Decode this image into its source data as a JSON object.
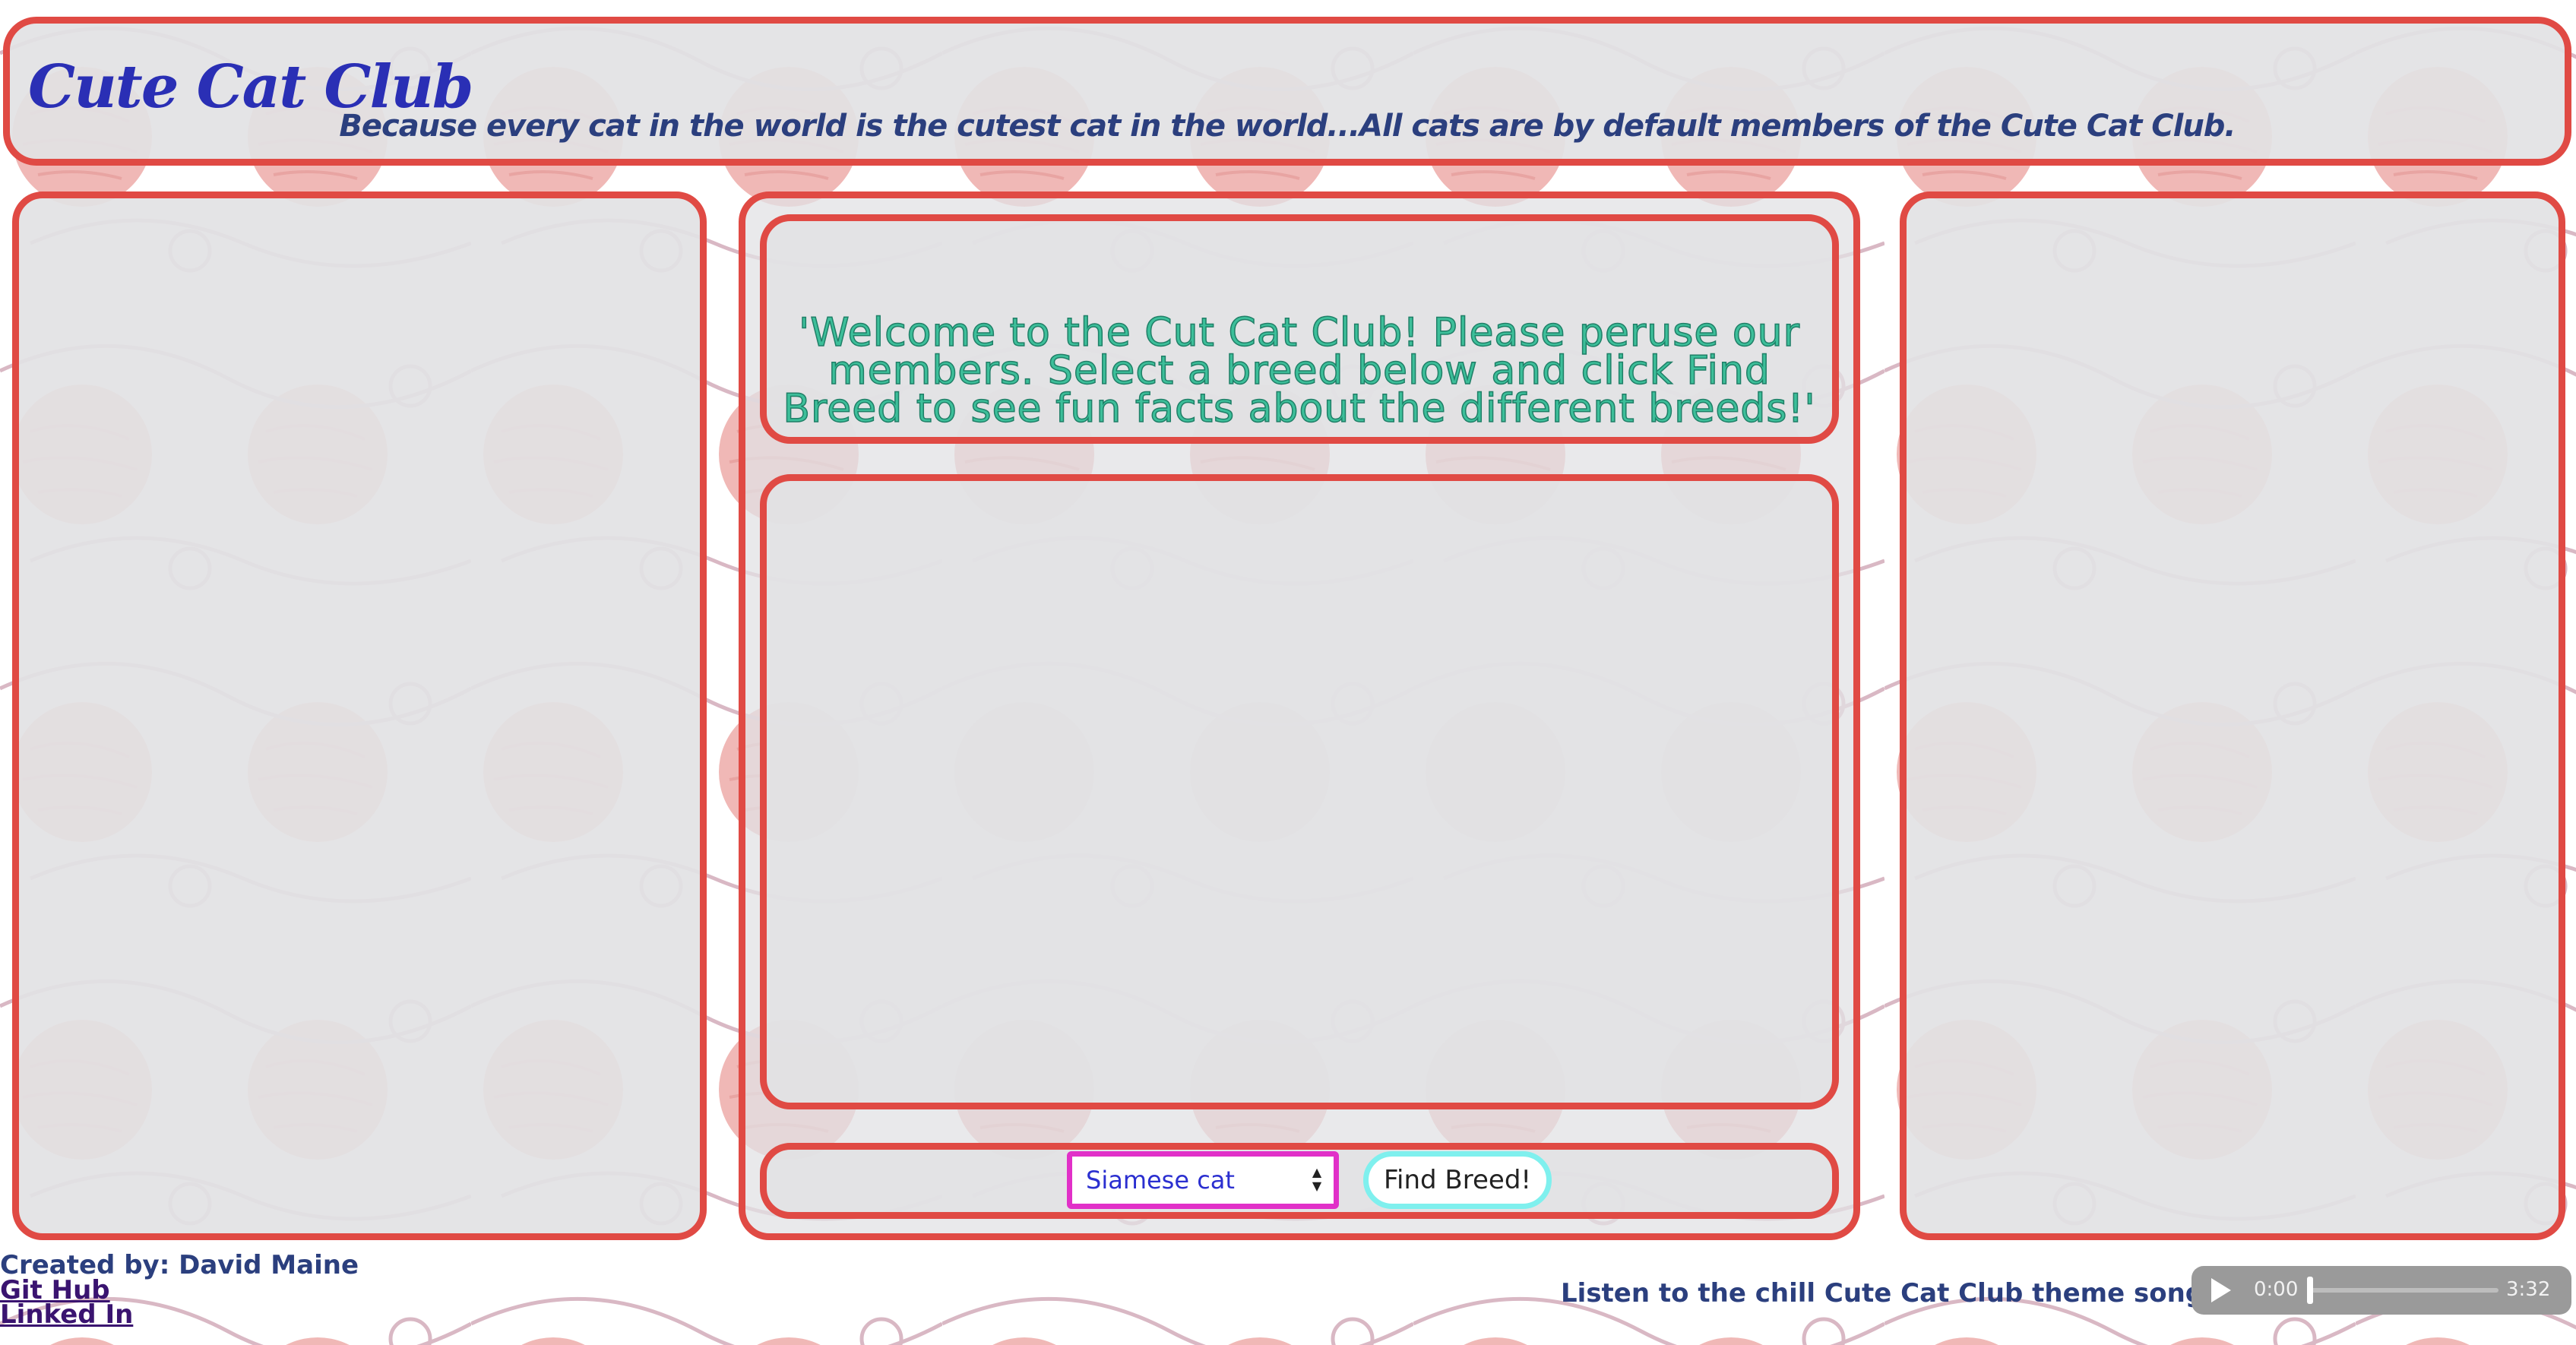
{
  "header": {
    "title": "Cute Cat Club",
    "tagline": "Because every cat in the world is the cutest cat in the world...All cats are by default members of the Cute Cat Club."
  },
  "welcome": {
    "message": "'Welcome to the Cut Cat Club! Please peruse our members. Select a breed below and click Find Breed to see fun facts about the different breeds!'"
  },
  "controls": {
    "selected_breed": "Siamese cat",
    "find_button_label": "Find Breed!"
  },
  "footer": {
    "credit": "Created by: David Maine",
    "github_link": "Git Hub",
    "linkedin_link": "Linked In",
    "song_prompt": "Listen to the chill Cute Cat Club theme song! =>"
  },
  "audio": {
    "current_time": "0:00",
    "duration": "3:32",
    "progress": 0
  },
  "colors": {
    "panel_border": "#e04a44",
    "title": "#2a2fb5",
    "tagline": "#2b3f7e",
    "welcome_text": "#3dbf9a",
    "select_border": "#e130c8",
    "button_border": "#7ff0ee"
  },
  "icons": {
    "background": "yarn-ball-icon",
    "audio_play": "play-icon",
    "select_arrows": "updown-arrows-icon"
  }
}
